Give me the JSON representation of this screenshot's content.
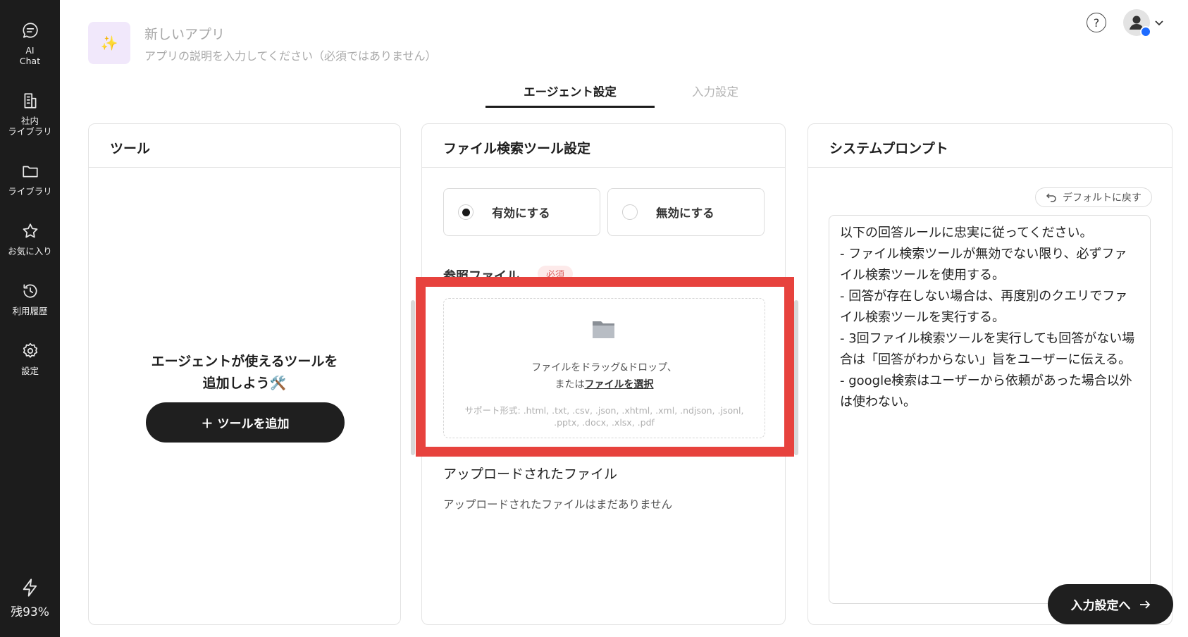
{
  "sidebar": {
    "items": [
      {
        "label": "AI\nChat",
        "icon": "chat-icon"
      },
      {
        "label": "社内\nライブラリ",
        "icon": "building-icon"
      },
      {
        "label": "ライブラリ",
        "icon": "folder-icon"
      },
      {
        "label": "お気に入り",
        "icon": "star-icon"
      },
      {
        "label": "利用履歴",
        "icon": "history-icon"
      },
      {
        "label": "設定",
        "icon": "gear-icon"
      }
    ],
    "credit": "残93%"
  },
  "header": {
    "app_icon": "✨",
    "app_name": "新しいアプリ",
    "app_description": "アプリの説明を入力してください（必須ではありません）"
  },
  "tabs": [
    {
      "label": "エージェント設定",
      "active": true
    },
    {
      "label": "入力設定",
      "active": false
    }
  ],
  "tools_panel": {
    "title": "ツール",
    "empty_message": "エージェントが使えるツールを\n追加しよう🛠️",
    "add_button": "＋  ツールを追加"
  },
  "file_panel": {
    "title": "ファイル検索ツール設定",
    "enable_label": "有効にする",
    "disable_label": "無効にする",
    "selected": "enable",
    "ref_label": "参照ファイル",
    "required_badge": "必須",
    "drop_text": "ファイルをドラッグ&ドロップ、",
    "drop_or": "または",
    "drop_link": "ファイルを選択",
    "supported": "サポート形式: .html, .txt, .csv, .json, .xhtml, .xml, .ndjson, .jsonl, .pptx, .docx, .xlsx, .pdf",
    "uploaded_title": "アップロードされたファイル",
    "uploaded_empty": "アップロードされたファイルはまだありません"
  },
  "prompt_panel": {
    "title": "システムプロンプト",
    "reset_button": "デフォルトに戻す",
    "prompt_text": "以下の回答ルールに忠実に従ってください。\n - ファイル検索ツールが無効でない限り、必ずファイル検索ツールを使用する。\n - 回答が存在しない場合は、再度別のクエリでファイル検索ツールを実行する。\n - 3回ファイル検索ツールを実行しても回答がない場合は「回答がわからない」旨をユーザーに伝える。\n - google検索はユーザーから依頼があった場合以外は使わない。"
  },
  "footer": {
    "next_button": "入力設定へ"
  },
  "colors": {
    "sidebar_bg": "#1c1c1c",
    "highlight": "#e7423d",
    "button_bg": "#1f1f1f"
  }
}
